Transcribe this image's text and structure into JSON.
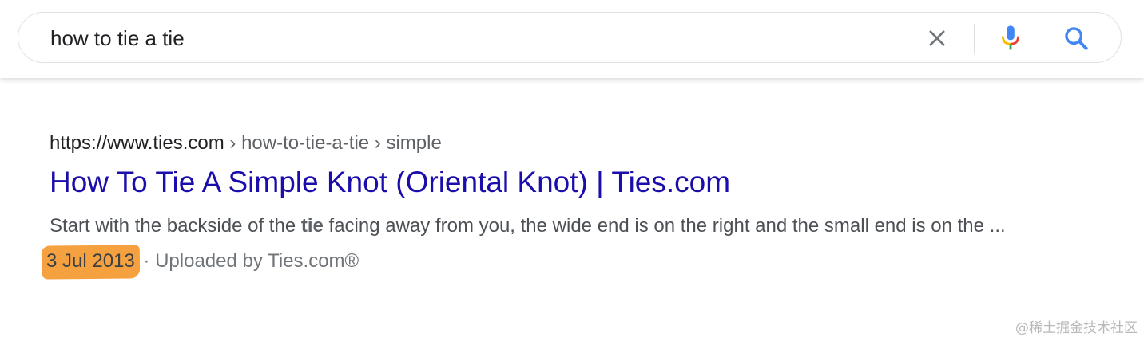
{
  "search": {
    "query": "how to tie a tie"
  },
  "icons": {
    "clear": "close-icon",
    "mic": "microphone-icon",
    "search": "search-icon"
  },
  "result": {
    "url_base": "https://www.ties.com",
    "url_path": " › how-to-tie-a-tie › simple",
    "title": "How To Tie A Simple Knot (Oriental Knot) | Ties.com",
    "snippet_before": "Start with the backside of the ",
    "snippet_bold": "tie",
    "snippet_after": " facing away from you, the wide end is on the right and the small end is on the ...",
    "date": "3 Jul 2013",
    "uploader": " · Uploaded by Ties.com®"
  },
  "watermark": "@稀土掘金技术社区",
  "colors": {
    "link": "#1a0dab",
    "highlight": "#f6a13f",
    "google_blue": "#4285f4"
  }
}
